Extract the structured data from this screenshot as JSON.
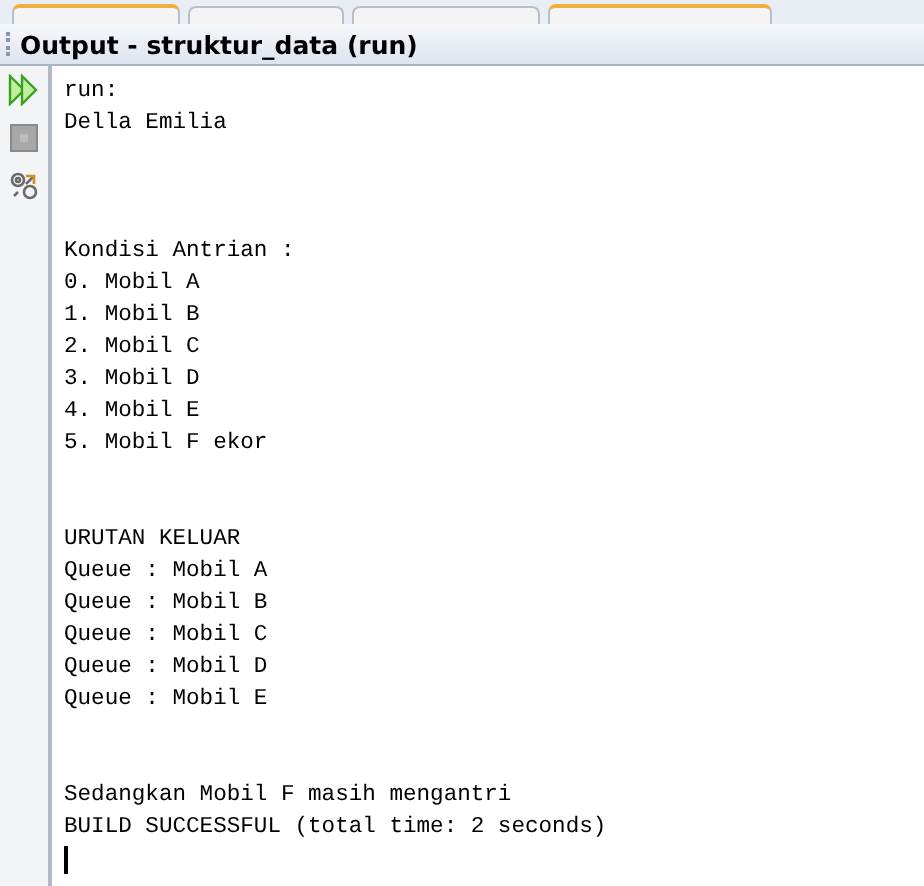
{
  "window": {
    "title": "Output - struktur_data (run)"
  },
  "toolbar": [
    {
      "kind": "rerun",
      "disabled": false
    },
    {
      "kind": "stop",
      "disabled": true
    },
    {
      "kind": "settings",
      "disabled": false
    }
  ],
  "output": {
    "blocks": [
      [
        "run:",
        "Della Emilia"
      ],
      [
        "Kondisi Antrian :",
        "0. Mobil A",
        "1. Mobil B",
        "2. Mobil C",
        "3. Mobil D",
        "4. Mobil E",
        "5. Mobil F ekor"
      ],
      [
        "URUTAN KELUAR",
        "Queue : Mobil A",
        "Queue : Mobil B",
        "Queue : Mobil C",
        "Queue : Mobil D",
        "Queue : Mobil E"
      ],
      [
        "Sedangkan Mobil F masih mengantri",
        "BUILD SUCCESSFUL (total time: 2 seconds)"
      ]
    ]
  }
}
